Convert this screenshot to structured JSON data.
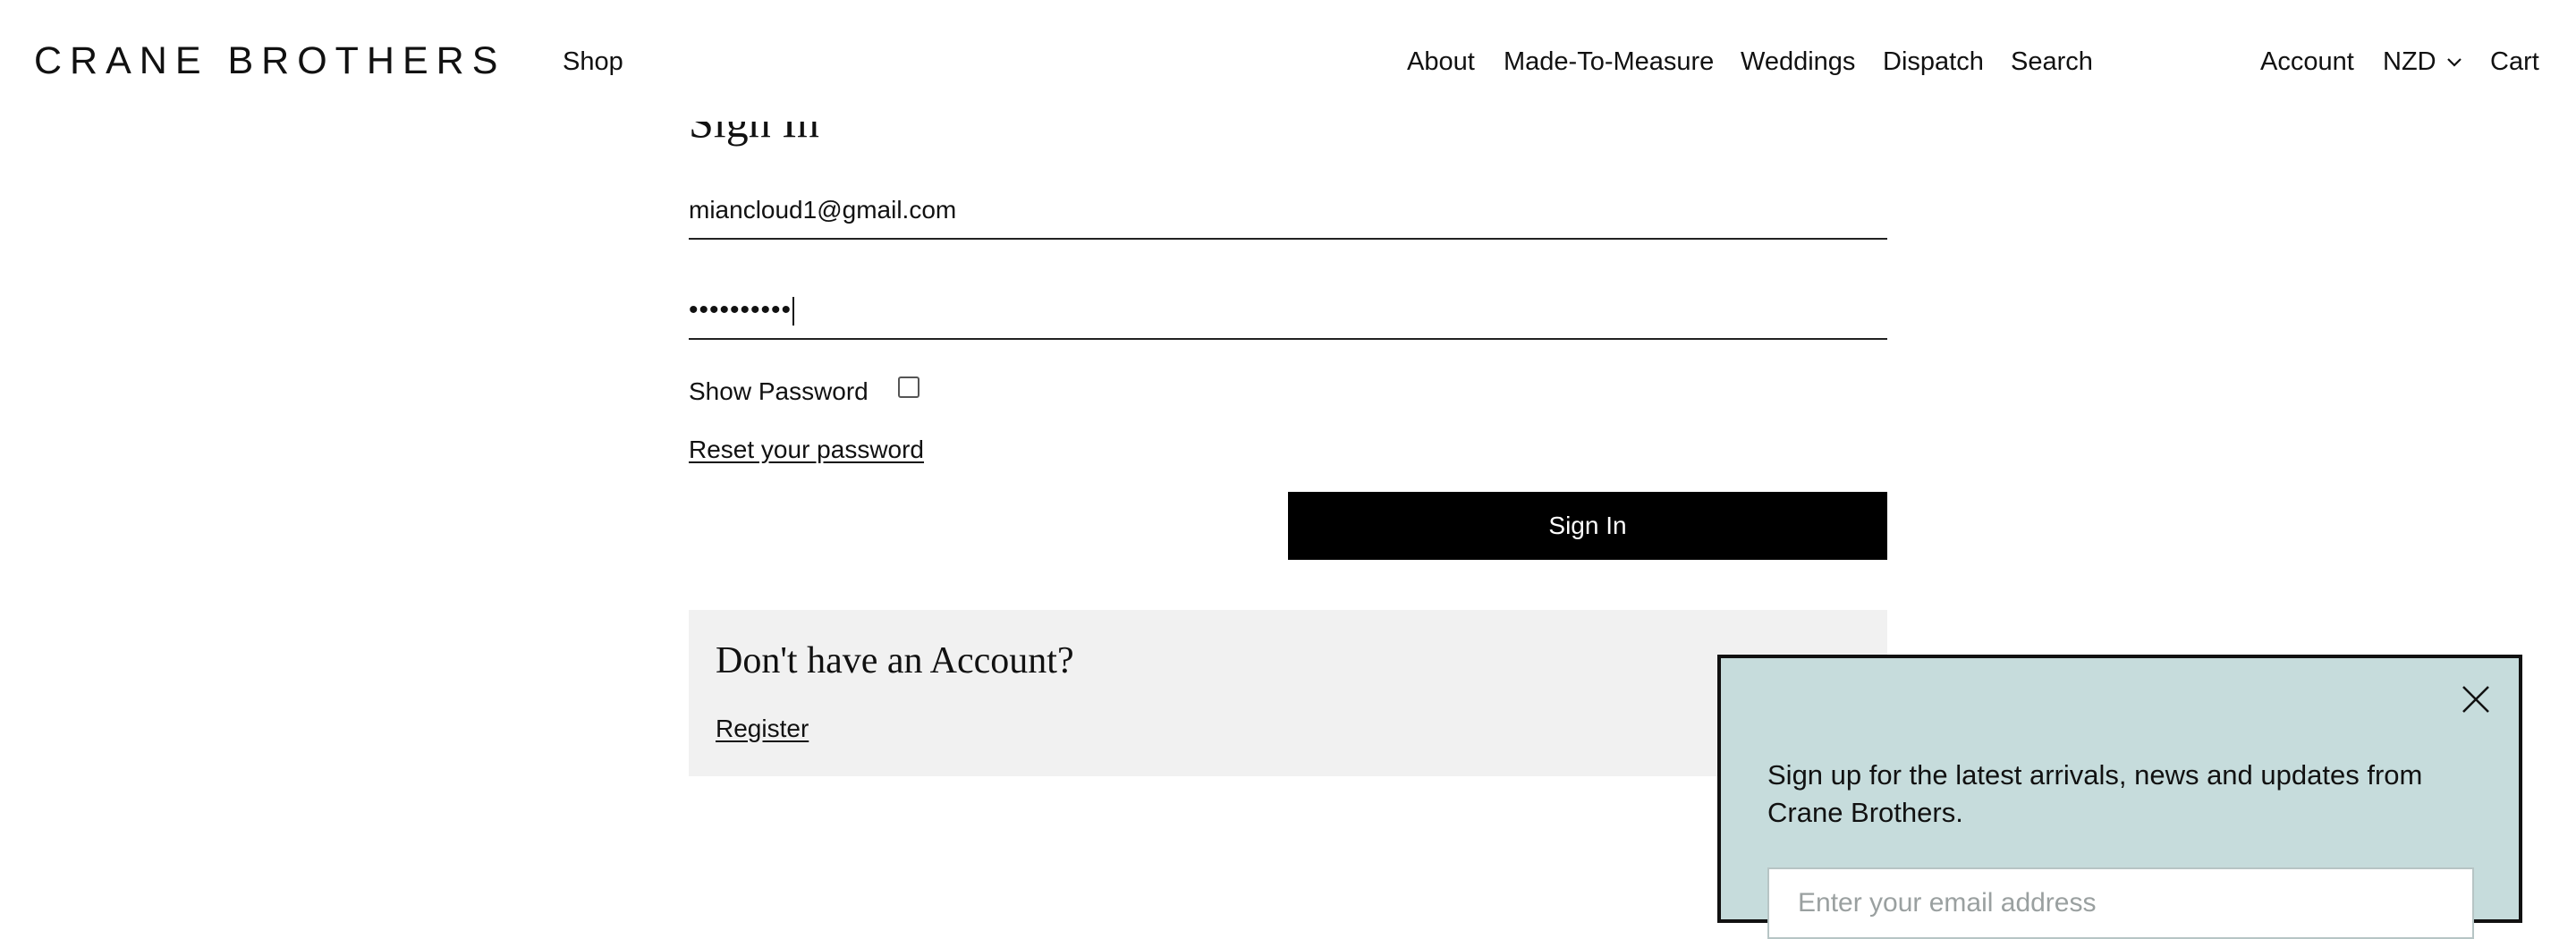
{
  "header": {
    "logo": "CRANE BROTHERS",
    "nav_left": [
      {
        "label": "Shop"
      }
    ],
    "nav_main": [
      {
        "label": "About"
      },
      {
        "label": "Made-To-Measure"
      },
      {
        "label": "Weddings"
      },
      {
        "label": "Dispatch"
      },
      {
        "label": "Search"
      }
    ],
    "nav_right": {
      "account": "Account",
      "currency": "NZD",
      "cart": "Cart"
    }
  },
  "signin": {
    "heading": "Sign In",
    "email_value": "miancloud1@gmail.com",
    "password_masked": "••••••••••",
    "show_password_label": "Show Password",
    "show_password_checked": false,
    "reset_link": "Reset your password",
    "submit_label": "Sign In"
  },
  "register": {
    "heading": "Don't have an Account?",
    "link": "Register"
  },
  "newsletter": {
    "text": "Sign up for the latest arrivals, news and updates from Crane Brothers.",
    "email_placeholder": "Enter your email address",
    "close_icon": "close-icon",
    "background": "#c6dcdc"
  }
}
